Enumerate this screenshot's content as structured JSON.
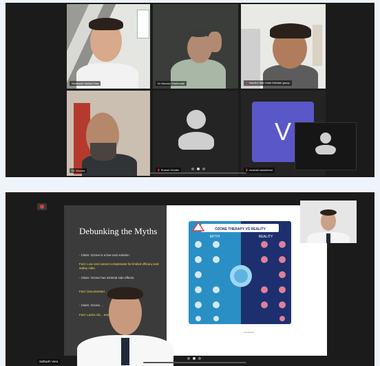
{
  "top_call": {
    "tiles": [
      {
        "name": "Siddharth Vardan Saa",
        "muted": false
      },
      {
        "name": "Dr Nimesh Shahbuddi",
        "muted": false
      },
      {
        "name": "Nandini Nair Hotel Mdcitee group",
        "muted": true
      },
      {
        "name": "Dr. Wozow",
        "muted": false
      },
      {
        "name": "Suresh Vhotler",
        "muted": true
      },
      {
        "name": "vrushali vasudevan",
        "muted": true
      }
    ],
    "avatar_letter": "V"
  },
  "bottom_call": {
    "presenter_name": "Sidharth Vera",
    "slide": {
      "title": "Debunking the Myths",
      "bullets": [
        {
          "text": "- Claim: Ozone is a low-cost solution.",
          "style": "claim"
        },
        {
          "text": "Fact: Low cost cannot compensate for limited efficacy and safety risks.",
          "style": "fact"
        },
        {
          "text": "- Claim: Ozone has minimal side effects.",
          "style": "claim"
        },
        {
          "text": "Fact: Documented ... infections and ...",
          "style": "fact"
        },
        {
          "text": "- Claim: Ozone ...",
          "style": "claim"
        },
        {
          "text": "Fact: Lacks rob... evidence.",
          "style": "fact"
        }
      ],
      "infographic": {
        "banner": "OZONE THERAPY VS REALITY",
        "myth_label": "MYTH",
        "reality_label": "REALITY",
        "caption": "SOURCES"
      }
    }
  },
  "colors": {
    "page_bg": "#eef4fb",
    "call_bg": "#1b1b1b",
    "active_speaker": "#3ec16a",
    "avatar_purple": "#5a57c8",
    "muted_red": "#e23b3b",
    "fact_yellow": "#e8e34a"
  }
}
